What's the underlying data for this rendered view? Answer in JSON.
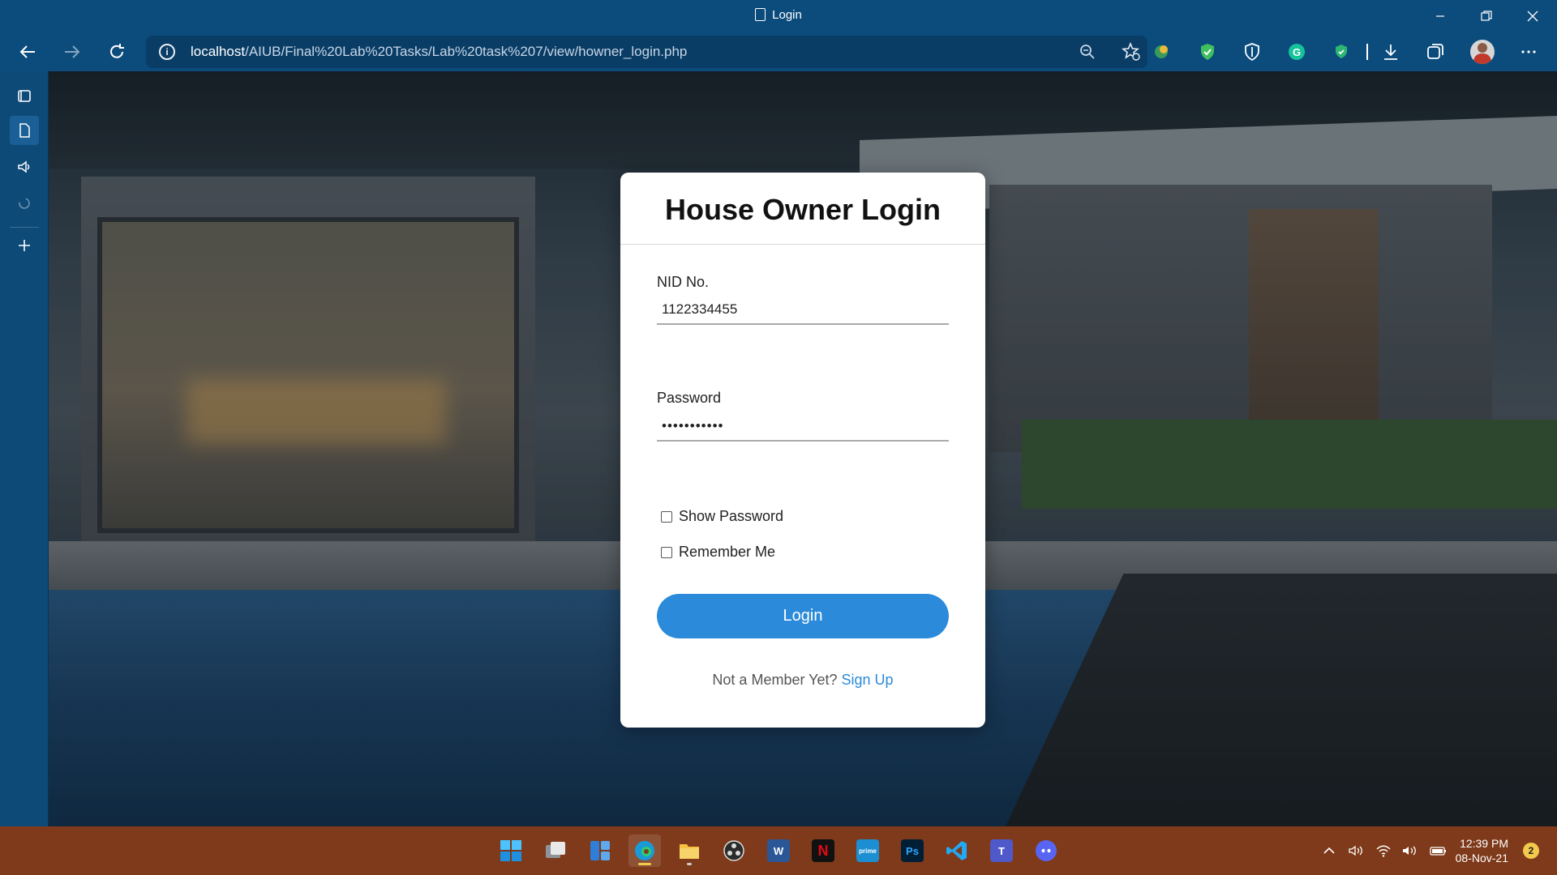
{
  "window": {
    "title": "Login"
  },
  "address_bar": {
    "url_host": "localhost",
    "url_path": "/AIUB/Final%20Lab%20Tasks/Lab%20task%207/view/howner_login.php"
  },
  "form": {
    "title": "House Owner Login",
    "nid_label": "NID No.",
    "nid_value": "1122334455",
    "password_label": "Password",
    "password_value": "•••••••••••",
    "show_password_label": "Show Password",
    "remember_me_label": "Remember Me",
    "login_label": "Login",
    "signup_prompt": "Not a Member Yet?",
    "signup_link": "Sign Up"
  },
  "taskbar": {
    "time": "12:39 PM",
    "date": "08-Nov-21",
    "notification_count": "2"
  },
  "colors": {
    "browser_chrome": "#0c4c7d",
    "accent": "#2b8ad9",
    "taskbar": "#7e3a1a"
  }
}
